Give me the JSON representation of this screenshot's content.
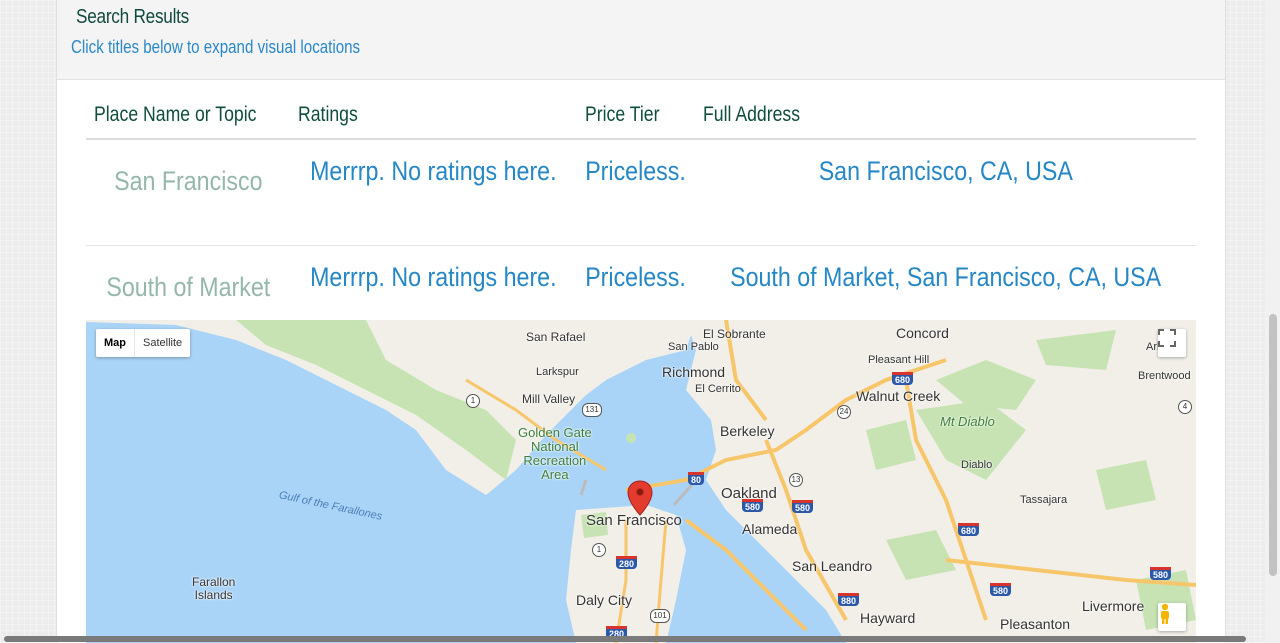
{
  "header": {
    "title": "Search Results",
    "subtitle": "Click titles below to expand visual locations"
  },
  "table": {
    "columns": [
      "Place Name or Topic",
      "Ratings",
      "Price Tier",
      "Full Address"
    ],
    "rows": [
      {
        "place": "San Francisco",
        "rating": "Merrrp. No ratings here.",
        "price": "Priceless.",
        "address": "San Francisco, CA, USA"
      },
      {
        "place": "South of Market",
        "rating": "Merrrp. No ratings here.",
        "price": "Priceless.",
        "address": "South of Market, San Francisco, CA, USA"
      }
    ]
  },
  "map": {
    "type_controls": [
      "Map",
      "Satellite"
    ],
    "active_type": "Map",
    "icons": [
      "fullscreen-icon",
      "pegman-icon",
      "map-marker-icon"
    ],
    "labels": {
      "san_rafael": "San Rafael",
      "el_sobrante": "El Sobrante",
      "concord": "Concord",
      "san_pablo": "San Pablo",
      "pleasant_hill": "Pleasant Hill",
      "arbo": "Arbo",
      "larkspur": "Larkspur",
      "richmond": "Richmond",
      "brentwood": "Brentwood",
      "el_cerrito": "El Cerrito",
      "walnut_creek": "Walnut Creek",
      "mill_valley": "Mill Valley",
      "mt_diablo": "Mt Diablo",
      "berkeley": "Berkeley",
      "ggnra": "Golden Gate\nNational\nRecreation\nArea",
      "diablo": "Diablo",
      "gulf": "Gulf of the Farallones",
      "oakland": "Oakland",
      "tassajara": "Tassajara",
      "san_francisco": "San Francisco",
      "alameda": "Alameda",
      "farallon": "Farallon\nIslands",
      "san_leandro": "San Leandro",
      "daly_city": "Daly City",
      "livermore": "Livermore",
      "hayward": "Hayward",
      "pleasanton": "Pleasanton"
    },
    "shields": {
      "i580a": "580",
      "i680a": "680",
      "i80": "80",
      "i580b": "580",
      "i680b": "680",
      "i280": "280",
      "i880": "880",
      "i580c": "580",
      "i580d": "580",
      "i280b": "280"
    },
    "routes": {
      "r1a": "1",
      "r131": "131",
      "r24": "24",
      "r13": "13",
      "r1b": "1",
      "r101": "101",
      "r4": "4"
    },
    "colors": {
      "water": "#aad4f7",
      "land": "#f2efe9",
      "park": "#c7e3b4",
      "highway": "#f7c66b",
      "marker": "#e33b2e"
    }
  }
}
